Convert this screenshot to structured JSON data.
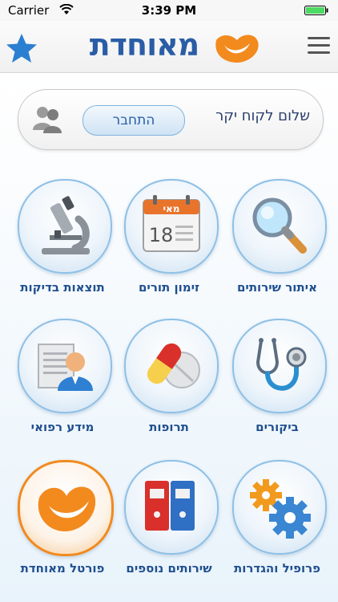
{
  "status_bar": {
    "carrier": "Carrier",
    "time": "3:39 PM"
  },
  "header": {
    "logo_text": "מאוחדת"
  },
  "greeting": {
    "text": "שלום לקוח יקר",
    "connect_label": "התחבר"
  },
  "tiles": {
    "service_locator": "איתור שירותים",
    "appointments": "זימון תורים",
    "test_results": "תוצאות בדיקות",
    "visits": "ביקורים",
    "medications": "תרופות",
    "medical_info": "מידע רפואי",
    "profile_settings": "פרופיל והגדרות",
    "more_services": "שירותים נוספים",
    "maccabi_portal": "פורטל מאוחדת"
  },
  "calendar_icon": {
    "month": "מאי",
    "day": "18"
  },
  "colors": {
    "brand_blue": "#2a5da6",
    "accent_orange": "#f28a1e",
    "tile_border": "#8ec0e6"
  }
}
